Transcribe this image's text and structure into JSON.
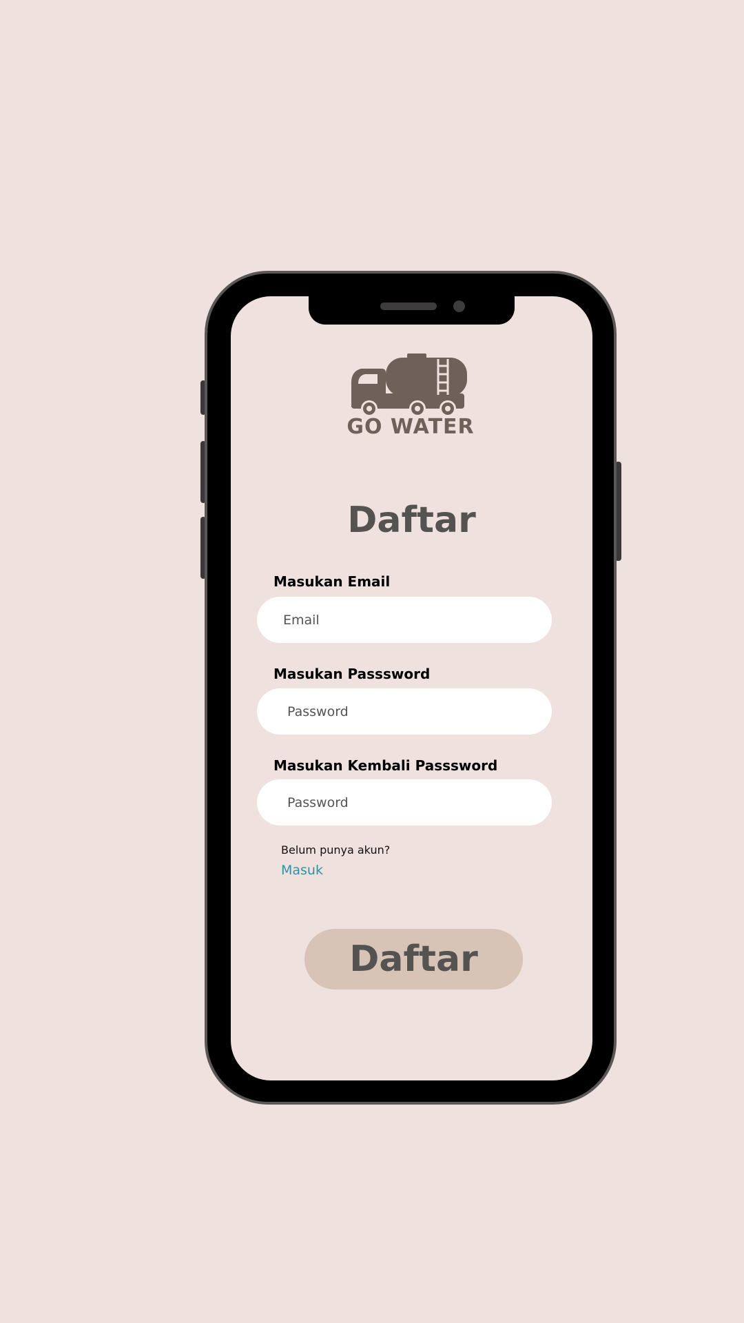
{
  "brand": {
    "logo_text": "GO WATER",
    "logo_icon": "water-tanker-truck-icon",
    "logo_color": "#70605a"
  },
  "page": {
    "title": "Daftar",
    "background_color": "#efe1de"
  },
  "form": {
    "email_label": "Masukan Email",
    "email_placeholder": "Email",
    "password_label": "Masukan Passsword",
    "password_placeholder": "Password",
    "confirm_label": "Masukan Kembali Passsword",
    "confirm_placeholder": "Password"
  },
  "account_prompt": {
    "text": "Belum punya akun?",
    "link_label": "Masuk",
    "link_color": "#2b93a6"
  },
  "submit": {
    "label": "Daftar",
    "background_color": "#d8c4b7"
  }
}
